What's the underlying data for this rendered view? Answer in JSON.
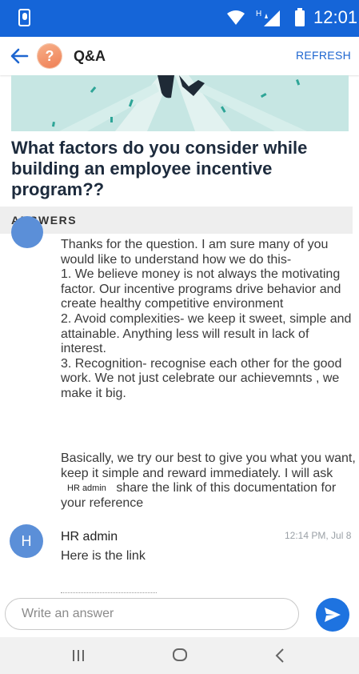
{
  "status_bar": {
    "time": "12:01",
    "network_label": "H",
    "icons": [
      "phone-icon",
      "wifi-icon",
      "signal-icon",
      "battery-icon"
    ]
  },
  "app_bar": {
    "title": "Q&A",
    "avatar_mark": "?",
    "refresh_label": "REFRESH",
    "icons": [
      "back-arrow-icon",
      "question-mark-icon"
    ]
  },
  "question": {
    "title": "What factors do you consider while building an employee incentive program??"
  },
  "answers": {
    "header": "ANSWERS",
    "first": {
      "body": "Thanks for the question. I am sure many of you would like to understand how we do this-\n1. We believe money is not always the motivating factor. Our incentive programs drive behavior and create healthy competitive environment\n2. Avoid complexities- we keep it sweet, simple and attainable. Anything less will result in lack of interest.\n3. Recognition-  recognise each other for the good work. We not just celebrate our achievemnts , we make it big.",
      "closing_before": "Basically, we try our best to give you what you want, keep it simple and reward immediately. I will ask",
      "mention": "HR admin",
      "closing_after": "share the link of this documentation for your reference"
    },
    "reply": {
      "avatar_letter": "H",
      "author": "HR admin",
      "time": "12:14 PM, Jul 8",
      "text": "Here is the link"
    }
  },
  "composer": {
    "placeholder": "Write an answer",
    "send_icon": "send-icon"
  },
  "nav_bar": {
    "icons": [
      "recents-icon",
      "home-icon",
      "back-icon"
    ]
  },
  "colors": {
    "status_bar": "#1565d8",
    "accent": "#1e66d0",
    "avatar": "#5b8fd8",
    "hero": "#c6e6e3"
  }
}
